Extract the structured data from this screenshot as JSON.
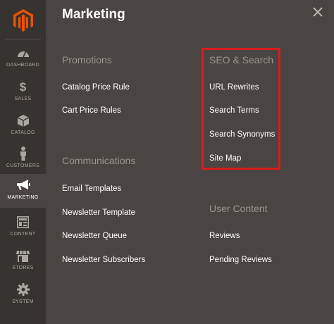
{
  "sidebar": {
    "items": [
      {
        "label": "DASHBOARD",
        "icon": "dashboard-icon"
      },
      {
        "label": "SALES",
        "icon": "dollar-icon"
      },
      {
        "label": "CATALOG",
        "icon": "cube-icon"
      },
      {
        "label": "CUSTOMERS",
        "icon": "person-icon"
      },
      {
        "label": "MARKETING",
        "icon": "megaphone-icon"
      },
      {
        "label": "CONTENT",
        "icon": "layout-icon"
      },
      {
        "label": "STORES",
        "icon": "storefront-icon"
      },
      {
        "label": "SYSTEM",
        "icon": "gear-icon"
      }
    ],
    "active_item": "MARKETING",
    "brand_color": "#eb5202"
  },
  "panel": {
    "title": "Marketing",
    "sections": {
      "promotions": {
        "title": "Promotions",
        "links": [
          "Catalog Price Rule",
          "Cart Price Rules"
        ]
      },
      "communications": {
        "title": "Communications",
        "links": [
          "Email Templates",
          "Newsletter Template",
          "Newsletter Queue",
          "Newsletter Subscribers"
        ]
      },
      "seo_search": {
        "title": "SEO & Search",
        "links": [
          "URL Rewrites",
          "Search Terms",
          "Search Synonyms",
          "Site Map"
        ]
      },
      "user_content": {
        "title": "User Content",
        "links": [
          "Reviews",
          "Pending Reviews"
        ]
      }
    }
  },
  "colors": {
    "panel_bg": "#4a4542",
    "sidebar_bg": "#373330",
    "highlight_border": "#d91c1c",
    "section_title": "#9c9590"
  }
}
